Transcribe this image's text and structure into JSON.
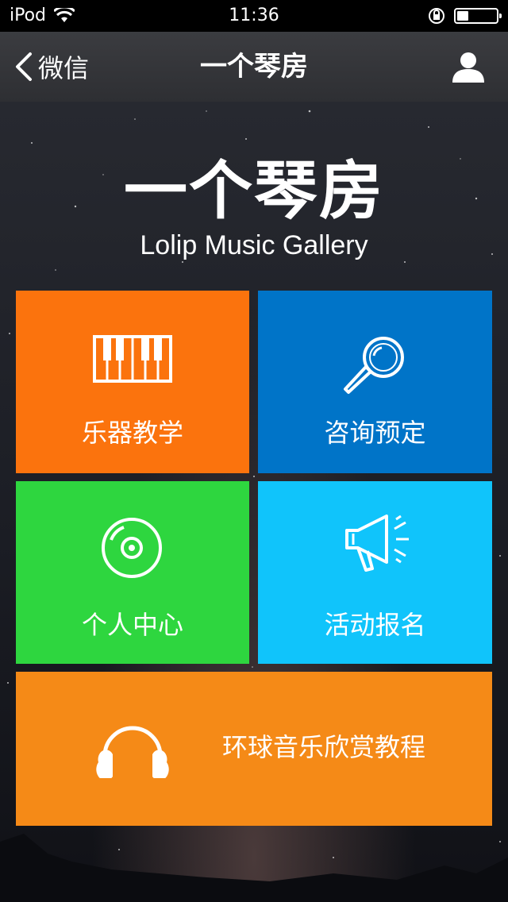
{
  "status_bar": {
    "device": "iPod",
    "time": "11:36"
  },
  "nav": {
    "back_label": "微信",
    "title": "一个琴房"
  },
  "logo": {
    "cn": "一个琴房",
    "en": "Lolip Music Gallery"
  },
  "tiles": [
    {
      "label": "乐器教学",
      "color": "#fb730d",
      "icon": "piano-icon"
    },
    {
      "label": "咨询预定",
      "color": "#0074c8",
      "icon": "magnifier-icon"
    },
    {
      "label": "个人中心",
      "color": "#2ed63f",
      "icon": "disc-icon"
    },
    {
      "label": "活动报名",
      "color": "#10c4fb",
      "icon": "megaphone-icon"
    },
    {
      "label": "环球音乐欣赏教程",
      "color": "#f58a17",
      "icon": "headphones-icon"
    }
  ]
}
